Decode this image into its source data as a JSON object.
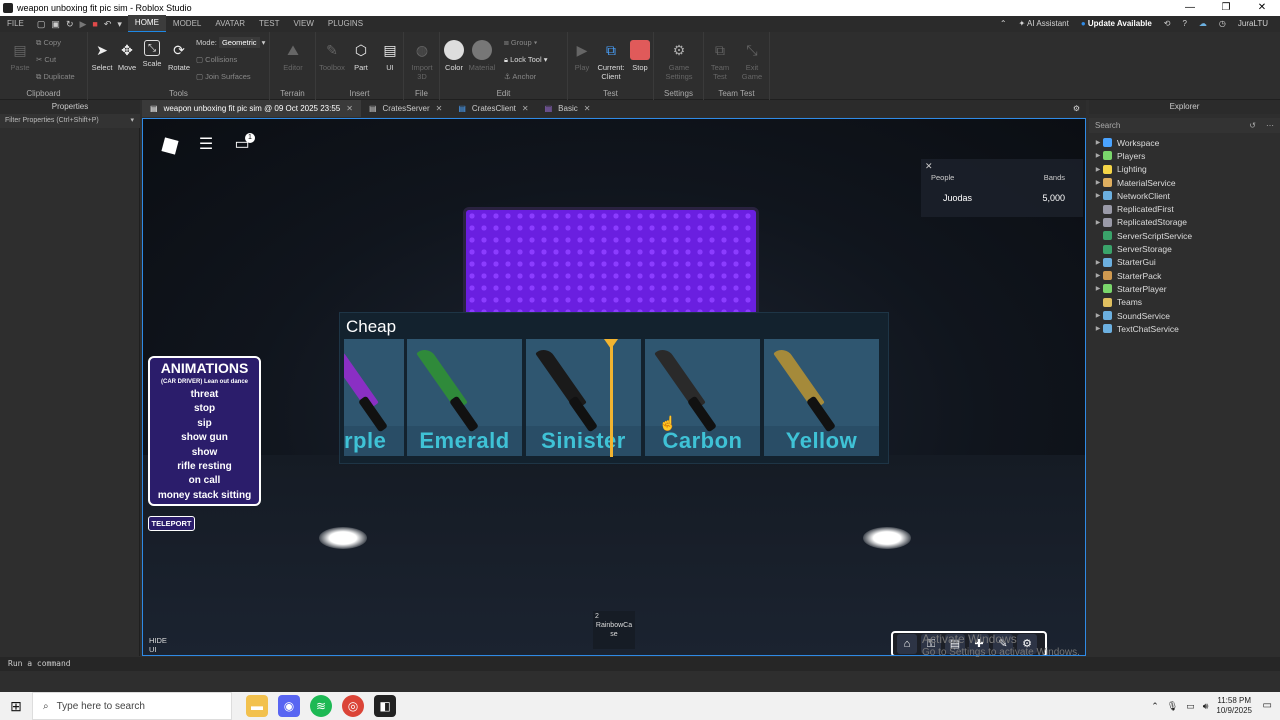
{
  "window": {
    "title": "weapon unboxing fit pic sim - Roblox Studio",
    "controls": [
      "—",
      "❐",
      "✕"
    ]
  },
  "menu": {
    "file": "FILE",
    "tabs": [
      "HOME",
      "MODEL",
      "AVATAR",
      "TEST",
      "VIEW",
      "PLUGINS"
    ],
    "active_tab": "HOME",
    "ai_assistant": "AI Assistant",
    "update": "Update Available",
    "user": "JuraLTU"
  },
  "ribbon": {
    "clipboard": {
      "label": "Clipboard",
      "paste": "Paste",
      "copy": "Copy",
      "cut": "Cut",
      "duplicate": "Duplicate"
    },
    "tools": {
      "label": "Tools",
      "select": "Select",
      "move": "Move",
      "scale": "Scale",
      "rotate": "Rotate",
      "mode_label": "Mode:",
      "mode_value": "Geometric",
      "collisions": "Collisions",
      "join_surfaces": "Join Surfaces"
    },
    "terrain": {
      "label": "Terrain",
      "editor": "Editor"
    },
    "insert": {
      "label": "Insert",
      "toolbox": "Toolbox",
      "part": "Part",
      "ui": "UI"
    },
    "file": {
      "label": "File",
      "import3d": "Import 3D"
    },
    "edit": {
      "label": "Edit",
      "color": "Color",
      "material": "Material",
      "group": "Group",
      "lock_tool": "Lock Tool",
      "anchor": "Anchor"
    },
    "test": {
      "label": "Test",
      "play": "Play",
      "current_client": "Current: Client",
      "stop": "Stop"
    },
    "settings": {
      "label": "Settings",
      "game_settings": "Game Settings"
    },
    "team_test": {
      "label": "Team Test",
      "team_test": "Team Test",
      "exit_game": "Exit Game"
    }
  },
  "properties": {
    "title": "Properties",
    "filter": "Filter Properties (Ctrl+Shift+P)"
  },
  "doc_tabs": [
    {
      "label": "weapon unboxing fit pic sim @ 09 Oct 2025 23:55",
      "active": true
    },
    {
      "label": "CratesServer",
      "active": false
    },
    {
      "label": "CratesClient",
      "active": false
    },
    {
      "label": "Basic",
      "active": false
    }
  ],
  "viewport": {
    "notification_count": "1",
    "leaderboard": {
      "col_people": "People",
      "col_bands": "Bands",
      "player": "Juodas",
      "bands": "5,000"
    },
    "spinner": {
      "title": "Cheap",
      "items": [
        {
          "name": "rple",
          "color": "#3fc2d6",
          "blade": "#8a2fc4"
        },
        {
          "name": "Emerald",
          "color": "#3fc2d6",
          "blade": "#2f8a3a"
        },
        {
          "name": "Sinister",
          "color": "#3fc2d6",
          "blade": "#1a1a1a"
        },
        {
          "name": "Carbon",
          "color": "#3fc2d6",
          "blade": "#2a2a2a"
        },
        {
          "name": "Yellow",
          "color": "#3fc2d6",
          "blade": "#a58a3a"
        }
      ]
    },
    "animations": {
      "title": "ANIMATIONS",
      "items": [
        "(CAR DRIVER) Lean out dance",
        "threat",
        "stop",
        "sip",
        "show gun",
        "show",
        "rifle resting",
        "on call",
        "money stack sitting"
      ]
    },
    "teleport": "TELEPORT",
    "hide_ui": [
      "HIDE",
      "UI"
    ],
    "case": {
      "count": "2",
      "name": "RainbowCase"
    },
    "activate": {
      "line1": "Activate Windows",
      "line2": "Go to Settings to activate Windows."
    }
  },
  "explorer": {
    "title": "Explorer",
    "search_placeholder": "Search",
    "items": [
      {
        "name": "Workspace",
        "color": "#4aa3ff",
        "expandable": true
      },
      {
        "name": "Players",
        "color": "#7ad66b",
        "expandable": true
      },
      {
        "name": "Lighting",
        "color": "#f5d547",
        "expandable": true
      },
      {
        "name": "MaterialService",
        "color": "#e0b060",
        "expandable": true
      },
      {
        "name": "NetworkClient",
        "color": "#6cb0e0",
        "expandable": true
      },
      {
        "name": "ReplicatedFirst",
        "color": "#9a9aa8",
        "expandable": false
      },
      {
        "name": "ReplicatedStorage",
        "color": "#9a9aa8",
        "expandable": true
      },
      {
        "name": "ServerScriptService",
        "color": "#3aa36a",
        "expandable": false
      },
      {
        "name": "ServerStorage",
        "color": "#3aa36a",
        "expandable": false
      },
      {
        "name": "StarterGui",
        "color": "#6cb0e0",
        "expandable": true
      },
      {
        "name": "StarterPack",
        "color": "#d09a50",
        "expandable": true
      },
      {
        "name": "StarterPlayer",
        "color": "#7ad66b",
        "expandable": true
      },
      {
        "name": "Teams",
        "color": "#e0c060",
        "expandable": false
      },
      {
        "name": "SoundService",
        "color": "#6cb0e0",
        "expandable": true
      },
      {
        "name": "TextChatService",
        "color": "#6cb0e0",
        "expandable": true
      }
    ]
  },
  "command_bar": {
    "placeholder": "Run a command"
  },
  "taskbar": {
    "search_placeholder": "Type here to search",
    "time": "11:58 PM",
    "date": "10/9/2025"
  }
}
